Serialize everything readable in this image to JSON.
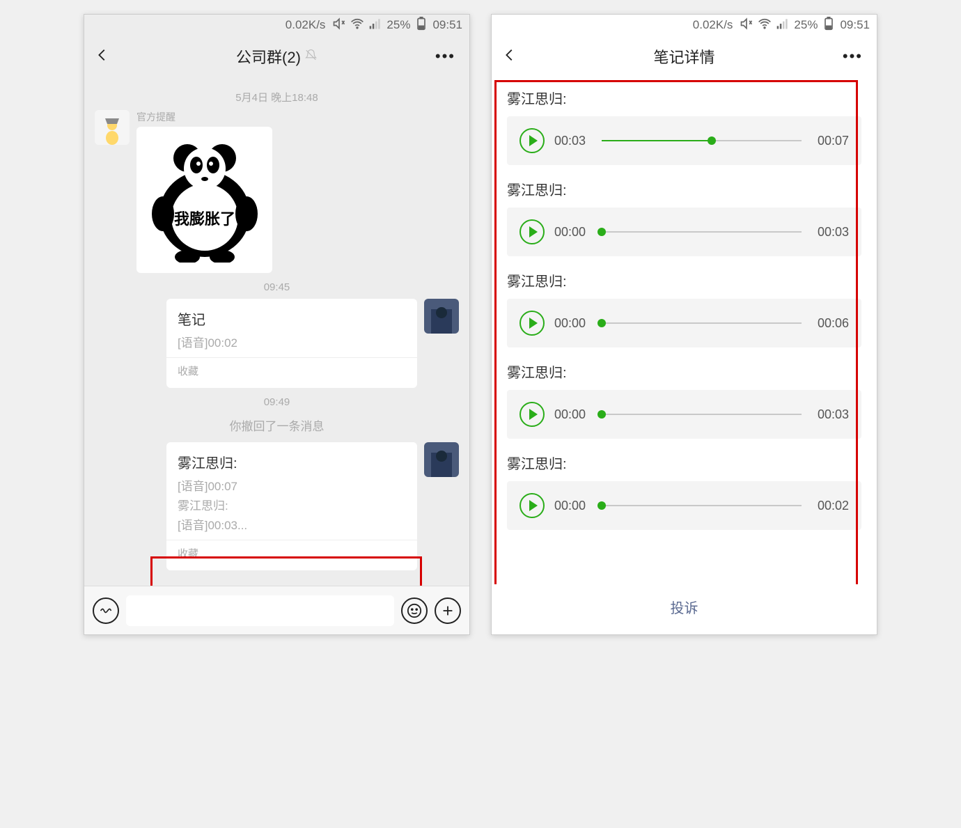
{
  "status": {
    "speed": "0.02K/s",
    "battery": "25%",
    "time": "09:51"
  },
  "left": {
    "header_title": "公司群(2)",
    "date_label": "5月4日 晚上18:48",
    "nickname1": "官方提醒",
    "sticker_text": "我膨胀了",
    "time1": "09:45",
    "note1": {
      "title": "笔记",
      "line1": "[语音]00:02",
      "source": "收藏"
    },
    "time2": "09:49",
    "recall_msg": "你撤回了一条消息",
    "note2": {
      "title": "雾江思归:",
      "line1": "[语音]00:07",
      "line2": "雾江思归:",
      "line3": "[语音]00:03...",
      "source": "收藏"
    }
  },
  "right": {
    "header_title": "笔记详情",
    "sender": "雾江思归:",
    "complain": "投诉",
    "audios": [
      {
        "current": "00:03",
        "total": "00:07",
        "progress": 55
      },
      {
        "current": "00:00",
        "total": "00:03",
        "progress": 0
      },
      {
        "current": "00:00",
        "total": "00:06",
        "progress": 0
      },
      {
        "current": "00:00",
        "total": "00:03",
        "progress": 0
      },
      {
        "current": "00:00",
        "total": "00:02",
        "progress": 0
      }
    ]
  }
}
